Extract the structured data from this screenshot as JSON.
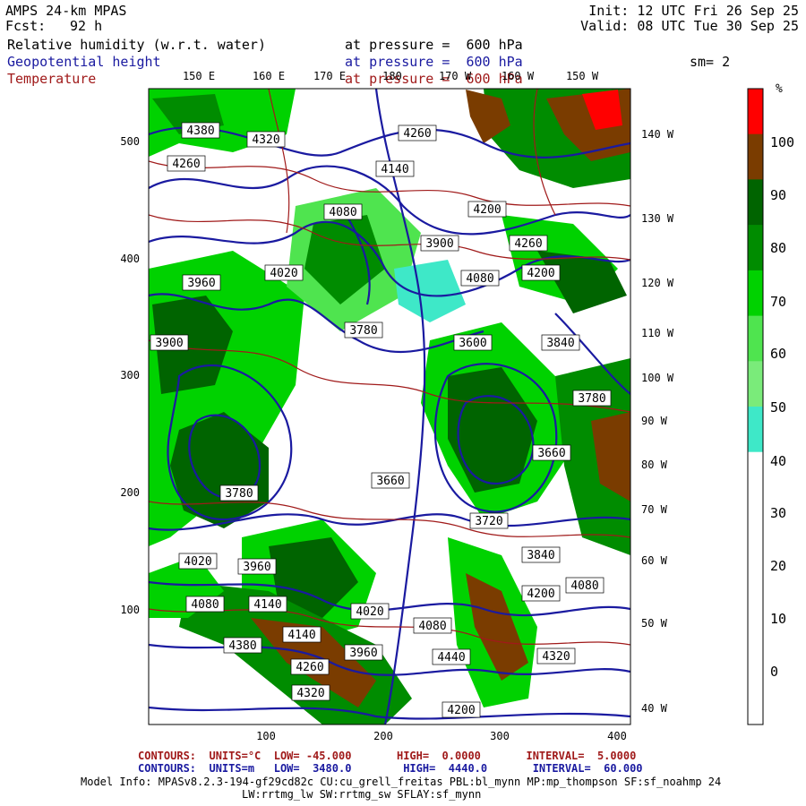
{
  "header": {
    "model": "AMPS 24-km MPAS",
    "fcst_label": "Fcst:",
    "fcst_value": "92 h",
    "init": "Init: 12 UTC Fri 26 Sep 25",
    "valid": "Valid: 08 UTC Tue 30 Sep 25",
    "smoothing": "sm= 2"
  },
  "fields": [
    {
      "name": "Relative humidity (w.r.t. water)",
      "level": "at pressure =  600 hPa",
      "color": "#000000"
    },
    {
      "name": "Geopotential height",
      "level": "at pressure =  600 hPa",
      "color": "#1a1aa0"
    },
    {
      "name": "Temperature",
      "level": "at pressure =  600 hPa",
      "color": "#a01a1a"
    }
  ],
  "map": {
    "x_ticks": [
      "100",
      "200",
      "300",
      "400"
    ],
    "y_ticks": [
      "100",
      "200",
      "300",
      "400",
      "500"
    ],
    "top_lons": [
      "150 E",
      "160 E",
      "170 E",
      "180",
      "170 W",
      "160 W",
      "150 W"
    ],
    "right_lons": [
      "140 W",
      "130 W",
      "120 W",
      "110 W",
      "100 W",
      "90 W",
      "80 W",
      "70 W",
      "60 W",
      "50 W",
      "40 W"
    ],
    "height_labels": [
      "4380",
      "4320",
      "4260",
      "4260",
      "4140",
      "4080",
      "4200",
      "3900",
      "4260",
      "4200",
      "4020",
      "3960",
      "4080",
      "3780",
      "3600",
      "3840",
      "3900",
      "3660",
      "3780",
      "3720",
      "3660",
      "3840",
      "3780",
      "4020",
      "3960",
      "4080",
      "4140",
      "4020",
      "4080",
      "4140",
      "4320",
      "4380",
      "4260",
      "3960",
      "4440",
      "4200",
      "4320",
      "4080",
      "4200"
    ]
  },
  "colorbar": {
    "unit": "%",
    "labels": [
      "100",
      "90",
      "80",
      "70",
      "60",
      "50",
      "40",
      "30",
      "20",
      "10",
      "0"
    ],
    "colors": [
      "#ff0000",
      "#7a3c00",
      "#006400",
      "#008c00",
      "#00d200",
      "#4fe44f",
      "#7aeb7a",
      "#3ee8c8",
      "#ffffff",
      "#ffffff",
      "#ffffff",
      "#ffffff",
      "#ffffff",
      "#ffffff"
    ]
  },
  "footer": {
    "temp_contours": "CONTOURS:  UNITS=°C  LOW= -45.000       HIGH=  0.0000       INTERVAL=  5.0000",
    "height_contours": "CONTOURS:  UNITS=m   LOW=  3480.0        HIGH=  4440.0       INTERVAL=  60.000",
    "model_info_1": "Model Info: MPASv8.2.3-194-gf29cd82c CU:cu_grell_freitas PBL:bl_mynn MP:mp_thompson SF:sf_noahmp 24",
    "model_info_2": "LW:rrtmg_lw SW:rrtmg_sw SFLAY:sf_mynn"
  }
}
